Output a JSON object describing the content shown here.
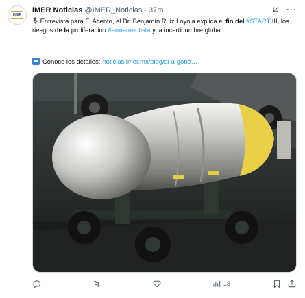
{
  "tweet": {
    "avatar_text": "IMER",
    "display_name": "IMER Noticias",
    "handle": "@IMER_Noticias",
    "separator": "·",
    "time": "37m",
    "text_parts": [
      {
        "t": " Entrevista para El Acento, el Dr. Benjamín Ruiz Loyola explica el ",
        "style": "normal"
      },
      {
        "t": "fin del",
        "style": "bold"
      },
      {
        "t": " ",
        "style": "normal"
      },
      {
        "t": "#START",
        "style": "hashtag"
      },
      {
        "t": " III, los riesgos ",
        "style": "normal"
      },
      {
        "t": "de la",
        "style": "bold"
      },
      {
        "t": " proliferación ",
        "style": "normal"
      },
      {
        "t": "#armamentista",
        "style": "hashtag"
      },
      {
        "t": " y la incertidumbre global.",
        "style": "normal"
      }
    ],
    "link_prefix": "Conoce los detalles:",
    "link_url": "noticias.imer.mx/blog/si-a-gobe…",
    "views": "13"
  },
  "icons": {
    "grok": "grok-icon",
    "more": "more-icon",
    "mic": "microphone-icon",
    "arrow": "arrow-right-icon",
    "reply": "reply-icon",
    "retweet": "retweet-icon",
    "like": "like-icon",
    "views": "views-icon",
    "bookmark": "bookmark-icon",
    "share": "share-icon"
  },
  "colors": {
    "accent": "#1d9bf0",
    "muted": "#536471",
    "text": "#0f1419"
  }
}
